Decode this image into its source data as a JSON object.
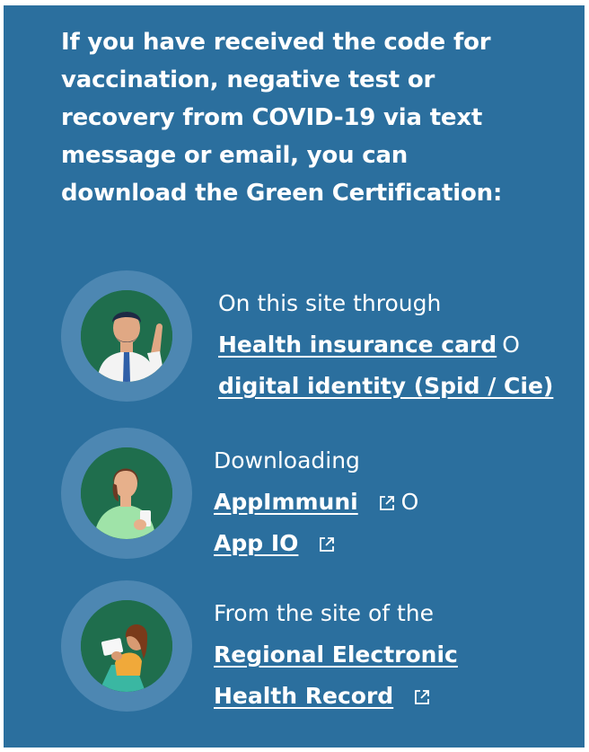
{
  "intro": {
    "text": "If you have received the code for vaccination, negative test or recovery from COVID-19 via text message or email, you can download the Green Certification:"
  },
  "options": [
    {
      "lead": "On this site through",
      "link1": "Health insurance card",
      "separator": "O",
      "link2": "digital identity (Spid / Cie)"
    },
    {
      "lead": "Downloading",
      "link1": "AppImmuni",
      "separator": "O",
      "link2": "App IO"
    },
    {
      "lead": "From the site of the",
      "link1": "Regional Electronic",
      "link2": "Health Record"
    }
  ],
  "colors": {
    "panel": "#2b6f9e",
    "ring": "#4d87b2",
    "avatar_bg": "#1f6e4d",
    "text": "#ffffff"
  },
  "icons": [
    "man-waving-icon",
    "woman-phone-icon",
    "woman-reading-icon",
    "external-link-icon"
  ]
}
